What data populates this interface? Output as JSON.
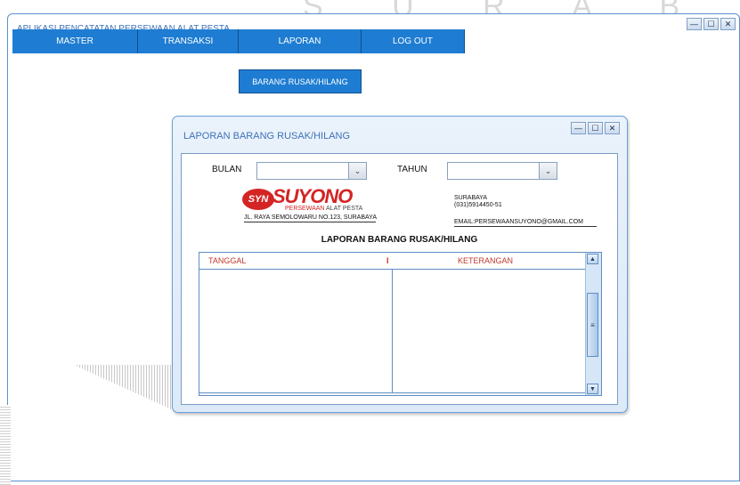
{
  "watermark": "S U R A B A Y A",
  "app": {
    "title": "APLIKASI PENCATATAN PERSEWAAN ALAT PESTA",
    "window_controls": {
      "minimize": "—",
      "maximize": "☐",
      "close": "✕"
    }
  },
  "menu": {
    "items": [
      {
        "label": "MASTER"
      },
      {
        "label": "TRANSAKSI"
      },
      {
        "label": "LAPORAN"
      },
      {
        "label": "LOG OUT"
      }
    ],
    "submenu": {
      "label": "BARANG RUSAK/HILANG"
    }
  },
  "report_window": {
    "title": "LAPORAN BARANG RUSAK/HILANG",
    "window_controls": {
      "minimize": "—",
      "maximize": "☐",
      "close": "✕"
    },
    "filters": {
      "month_label": "BULAN",
      "month_value": "",
      "year_label": "TAHUN",
      "year_value": ""
    },
    "company": {
      "badge": "SYN",
      "name": "SUYONO",
      "tagline_accent": "PERSEWAAN",
      "tagline_rest": "ALAT PESTA",
      "address": "JL. RAYA SEMOLOWARU NO.123, SURABAYA",
      "city": "SURABAYA",
      "phone": "(031)5914450-51",
      "email": "EMAIL:PERSEWAANSUYONO@GMAIL.COM"
    },
    "report_heading": "LAPORAN BARANG RUSAK/HILANG",
    "table": {
      "columns": [
        "TANGGAL",
        "KETERANGAN"
      ],
      "separator": "I",
      "rows": []
    }
  },
  "colors": {
    "accent": "#1e7dd2",
    "title_text": "#3e72b8",
    "brand_red": "#d42424",
    "column_header": "#c0392b"
  }
}
